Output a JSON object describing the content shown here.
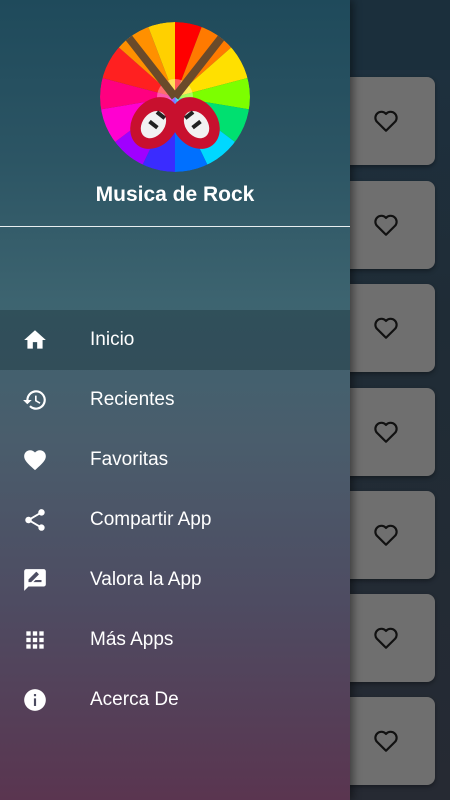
{
  "drawer": {
    "app_title": "Musica de Rock",
    "logo_icon": "rainbow-guitars-logo",
    "active_index": 0,
    "items": [
      {
        "label": "Inicio",
        "icon": "home-icon"
      },
      {
        "label": "Recientes",
        "icon": "history-icon"
      },
      {
        "label": "Favoritas",
        "icon": "heart-icon"
      },
      {
        "label": "Compartir App",
        "icon": "share-icon"
      },
      {
        "label": "Valora la App",
        "icon": "rate-review-icon"
      },
      {
        "label": "Más Apps",
        "icon": "apps-grid-icon"
      },
      {
        "label": "Acerca De",
        "icon": "info-icon"
      }
    ]
  },
  "background_list": {
    "favorite_icon": "heart-outline-icon",
    "card_count": 7
  },
  "colors": {
    "drawer_top": "#1f4a5b",
    "drawer_bottom": "#5a3550",
    "card": "#6f6f6f",
    "text": "#ffffff"
  }
}
